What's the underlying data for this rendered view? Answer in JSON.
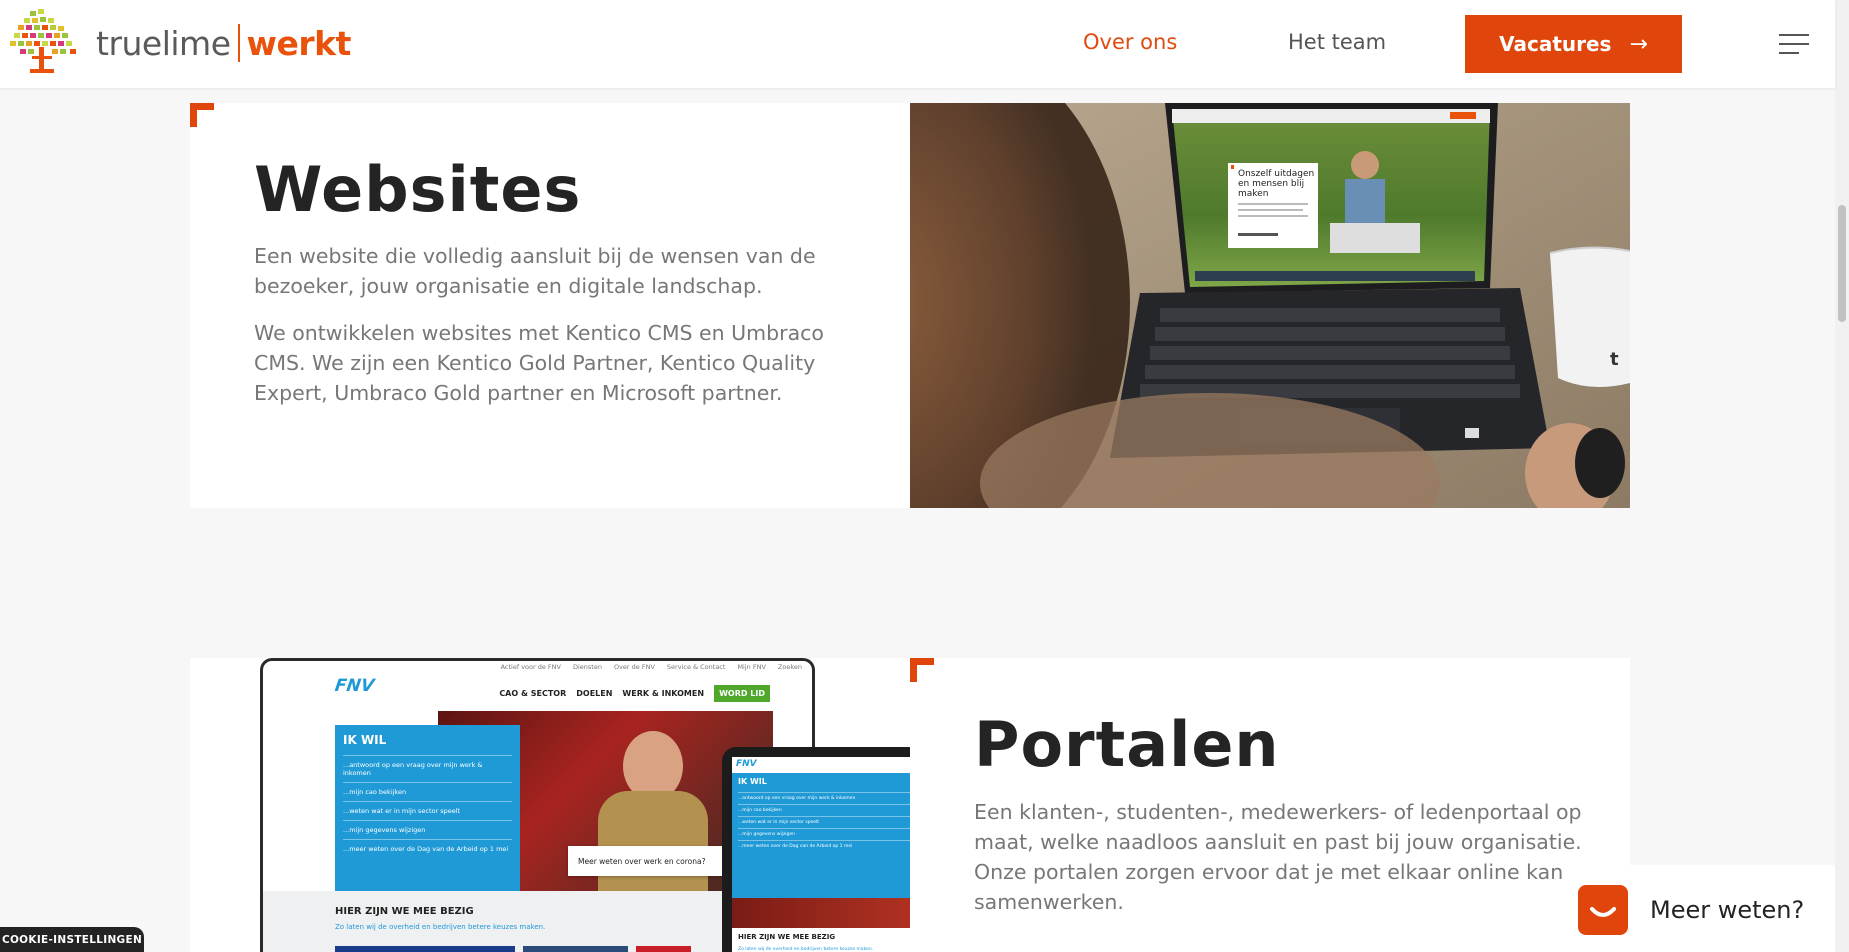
{
  "header": {
    "logo_part1": "truelime",
    "logo_part2": "werkt",
    "nav": [
      {
        "label": "Over ons",
        "active": true
      },
      {
        "label": "Het team",
        "active": false
      }
    ],
    "cta_label": "Vacatures",
    "cta_arrow": "→"
  },
  "colors": {
    "accent": "#e0460c",
    "text_dark": "#242424",
    "text_muted": "#777777"
  },
  "sections": [
    {
      "title": "Websites",
      "paragraphs": [
        "Een website die volledig aansluit bij de wensen van de bezoeker, jouw organisatie en digitale landschap.",
        "We ontwikkelen websites met Kentico CMS en Umbraco CMS. We zijn een Kentico Gold Partner, Kentico Quality Expert, Umbraco Gold partner en Microsoft partner."
      ],
      "laptop_screen_text": "Onszelf uitdagen en mensen blij maken"
    },
    {
      "title": "Portalen",
      "paragraphs": [
        "Een klanten-, studenten-, medewerkers- of ledenportaal op maat, welke naadloos aansluit en past bij jouw organisatie. Onze portalen zorgen ervoor dat je met elkaar online kan samenwerken."
      ],
      "mockup": {
        "brand": "FNV",
        "toplinks": [
          "Actief voor de FNV",
          "Diensten",
          "Over de FNV",
          "Service & Contact",
          "Mijn FNV",
          "Zoeken"
        ],
        "menu": [
          "CAO & SECTOR",
          "DOELEN",
          "WERK & INKOMEN"
        ],
        "menu_cta": "WORD LID",
        "panel_title": "IK WIL",
        "panel_items": [
          "...antwoord op een vraag over mijn werk & inkomen",
          "...mijn cao bekijken",
          "...weten wat er in mijn sector speelt",
          "...mijn gegevens wijzigen",
          "...meer weten over de Dag van de Arbeid op 1 mei"
        ],
        "card_text": "Meer weten over werk en corona?",
        "section_title": "HIER ZIJN WE MEE BEZIG",
        "section_sub": "Zo laten wij de overheid en bedrijven betere keuzes maken."
      }
    }
  ],
  "cookie_label": "COOKIE-INSTELLINGEN",
  "chat_label": "Meer weten?"
}
